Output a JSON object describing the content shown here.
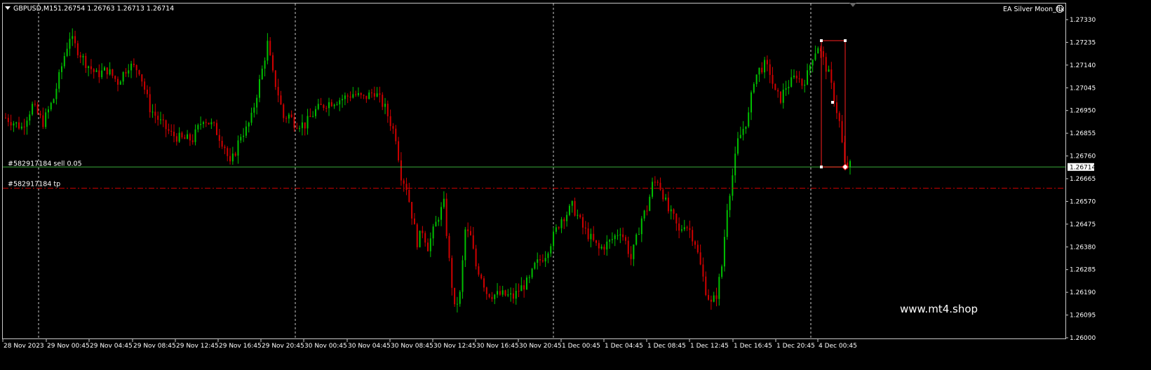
{
  "header": {
    "symbol": "GBPUSD,M15",
    "ohlc": "1.26754 1.26763 1.26713 1.26714",
    "ea_name": "EA Silver Moon_fix"
  },
  "watermark": "www.mt4.shop",
  "orders": {
    "sell_label": "#582917184 sell 0.05",
    "sell_price": 1.26714,
    "tp_label": "#582917184 tp",
    "tp_price": 1.26625
  },
  "current_price_label": "1.26714",
  "colors": {
    "background": "#000000",
    "bull": "#00c000",
    "bear": "#d00000",
    "order_line": "#3aa83a",
    "tp_line": "#d00000",
    "separator": "#c8c8c8",
    "rect": "#ff2020"
  },
  "chart_data": {
    "type": "candlestick",
    "timeframe": "M15",
    "symbol": "GBPUSD",
    "ylim": [
      1.2595,
      1.2738
    ],
    "yticks": [
      "1.27330",
      "1.27235",
      "1.27140",
      "1.27045",
      "1.26950",
      "1.26855",
      "1.26760",
      "1.26665",
      "1.26570",
      "1.26475",
      "1.26380",
      "1.26285",
      "1.26190",
      "1.26095",
      "1.26000"
    ],
    "xticks": [
      "28 Nov 2023",
      "29 Nov 00:45",
      "29 Nov 04:45",
      "29 Nov 08:45",
      "29 Nov 12:45",
      "29 Nov 16:45",
      "29 Nov 20:45",
      "30 Nov 00:45",
      "30 Nov 04:45",
      "30 Nov 08:45",
      "30 Nov 12:45",
      "30 Nov 16:45",
      "30 Nov 20:45",
      "1 Dec 00:45",
      "1 Dec 04:45",
      "1 Dec 08:45",
      "1 Dec 12:45",
      "1 Dec 16:45",
      "1 Dec 20:45",
      "4 Dec 00:45"
    ],
    "close_path": [
      [
        0,
        1.2692
      ],
      [
        6,
        1.2688
      ],
      [
        10,
        1.2697
      ],
      [
        14,
        1.269
      ],
      [
        18,
        1.27
      ],
      [
        22,
        1.2718
      ],
      [
        24,
        1.2726
      ],
      [
        26,
        1.2722
      ],
      [
        30,
        1.2715
      ],
      [
        34,
        1.271
      ],
      [
        38,
        1.2712
      ],
      [
        42,
        1.2707
      ],
      [
        46,
        1.2714
      ],
      [
        50,
        1.2712
      ],
      [
        54,
        1.2696
      ],
      [
        58,
        1.269
      ],
      [
        62,
        1.2685
      ],
      [
        66,
        1.2683
      ],
      [
        70,
        1.2683
      ],
      [
        74,
        1.2692
      ],
      [
        78,
        1.2688
      ],
      [
        82,
        1.268
      ],
      [
        84,
        1.2672
      ],
      [
        86,
        1.2678
      ],
      [
        88,
        1.2685
      ],
      [
        90,
        1.2687
      ],
      [
        92,
        1.2692
      ],
      [
        96,
        1.2712
      ],
      [
        98,
        1.2723
      ],
      [
        100,
        1.271
      ],
      [
        102,
        1.2702
      ],
      [
        104,
        1.2692
      ],
      [
        106,
        1.2693
      ],
      [
        108,
        1.269
      ],
      [
        112,
        1.2689
      ],
      [
        116,
        1.2695
      ],
      [
        120,
        1.2698
      ],
      [
        126,
        1.27
      ],
      [
        130,
        1.2702
      ],
      [
        134,
        1.27
      ],
      [
        138,
        1.2703
      ],
      [
        142,
        1.2696
      ],
      [
        146,
        1.2684
      ],
      [
        148,
        1.2668
      ],
      [
        150,
        1.2663
      ],
      [
        154,
        1.264
      ],
      [
        156,
        1.2645
      ],
      [
        158,
        1.2638
      ],
      [
        162,
        1.2651
      ],
      [
        164,
        1.2656
      ],
      [
        166,
        1.2632
      ],
      [
        168,
        1.2612
      ],
      [
        170,
        1.2618
      ],
      [
        172,
        1.2645
      ],
      [
        174,
        1.2642
      ],
      [
        176,
        1.263
      ],
      [
        178,
        1.2626
      ],
      [
        180,
        1.2619
      ],
      [
        182,
        1.2618
      ],
      [
        186,
        1.2618
      ],
      [
        190,
        1.2617
      ],
      [
        192,
        1.262
      ],
      [
        196,
        1.2624
      ],
      [
        198,
        1.263
      ],
      [
        202,
        1.2635
      ],
      [
        206,
        1.2645
      ],
      [
        208,
        1.265
      ],
      [
        210,
        1.2652
      ],
      [
        212,
        1.2655
      ],
      [
        214,
        1.2651
      ],
      [
        216,
        1.2646
      ],
      [
        218,
        1.2643
      ],
      [
        220,
        1.264
      ],
      [
        222,
        1.2637
      ],
      [
        226,
        1.264
      ],
      [
        230,
        1.2645
      ],
      [
        232,
        1.264
      ],
      [
        234,
        1.2633
      ],
      [
        236,
        1.2641
      ],
      [
        238,
        1.265
      ],
      [
        240,
        1.2654
      ],
      [
        242,
        1.2664
      ],
      [
        244,
        1.2666
      ],
      [
        246,
        1.266
      ],
      [
        248,
        1.2653
      ],
      [
        250,
        1.265
      ],
      [
        252,
        1.2644
      ],
      [
        254,
        1.2648
      ],
      [
        256,
        1.2645
      ],
      [
        258,
        1.264
      ],
      [
        260,
        1.263
      ],
      [
        262,
        1.262
      ],
      [
        264,
        1.2614
      ],
      [
        266,
        1.2618
      ],
      [
        268,
        1.263
      ],
      [
        270,
        1.2655
      ],
      [
        272,
        1.2668
      ],
      [
        274,
        1.2682
      ],
      [
        278,
        1.2693
      ],
      [
        280,
        1.2708
      ],
      [
        282,
        1.2712
      ],
      [
        284,
        1.2714
      ],
      [
        286,
        1.2711
      ],
      [
        288,
        1.2702
      ],
      [
        290,
        1.27
      ],
      [
        292,
        1.2705
      ],
      [
        294,
        1.2707
      ],
      [
        296,
        1.271
      ],
      [
        298,
        1.2706
      ],
      [
        300,
        1.271
      ],
      [
        302,
        1.2718
      ],
      [
        304,
        1.2722
      ],
      [
        306,
        1.2716
      ],
      [
        308,
        1.271
      ],
      [
        310,
        1.27
      ],
      [
        312,
        1.269
      ],
      [
        314,
        1.2672
      ],
      [
        316,
        1.2672
      ]
    ]
  }
}
